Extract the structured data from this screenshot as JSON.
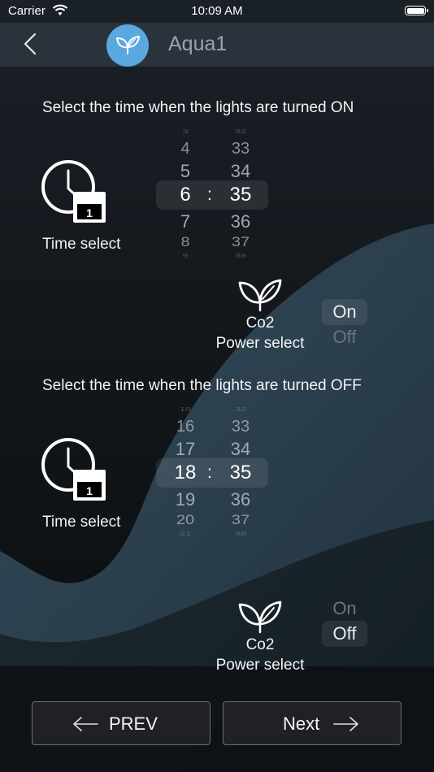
{
  "status_bar": {
    "carrier": "Carrier",
    "time": "10:09 AM"
  },
  "nav": {
    "title": "Aqua1",
    "logo_color": "#5aa8e0"
  },
  "on_section": {
    "heading": "Select the time when the lights are turned ON",
    "time_select_label": "Time select",
    "calendar_badge": "1",
    "picker": {
      "hours": [
        "3",
        "4",
        "5",
        "6",
        "7",
        "8",
        "9"
      ],
      "minutes": [
        "32",
        "33",
        "34",
        "35",
        "36",
        "37",
        "38"
      ],
      "separator": ":",
      "selected_hour": "6",
      "selected_minute": "35"
    },
    "co2_label": "Co2",
    "power_select_label": "Power select",
    "toggle": {
      "on_label": "On",
      "off_label": "Off",
      "selected": "On"
    }
  },
  "off_section": {
    "heading": "Select the time when the lights are turned OFF",
    "time_select_label": "Time select",
    "calendar_badge": "1",
    "picker": {
      "hours": [
        "15",
        "16",
        "17",
        "18",
        "19",
        "20",
        "21"
      ],
      "minutes": [
        "32",
        "33",
        "34",
        "35",
        "36",
        "37",
        "38"
      ],
      "separator": ":",
      "selected_hour": "18",
      "selected_minute": "35"
    },
    "co2_label": "Co2",
    "power_select_label": "Power select",
    "toggle": {
      "on_label": "On",
      "off_label": "Off",
      "selected": "Off"
    }
  },
  "footer": {
    "prev_label": "PREV",
    "next_label": "Next"
  }
}
